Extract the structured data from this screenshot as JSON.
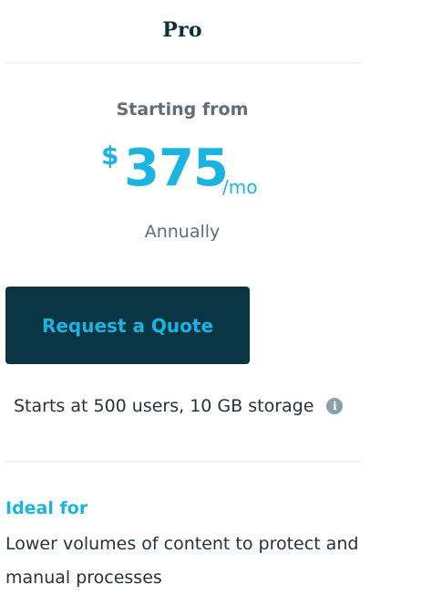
{
  "plan": {
    "name": "Pro",
    "starting_label": "Starting from",
    "currency": "$",
    "amount": "375",
    "period": "/mo",
    "billing": "Annually"
  },
  "cta": {
    "label": "Request a Quote"
  },
  "limits": {
    "text": "Starts at 500 users, 10 GB storage",
    "info_icon": "info-icon"
  },
  "ideal_for": {
    "label": "Ideal for",
    "description": "Lower volumes of content to protect and manual processes"
  },
  "colors": {
    "accent": "#1bb4e0",
    "button_bg": "#093544",
    "title": "#0b2f3c"
  }
}
